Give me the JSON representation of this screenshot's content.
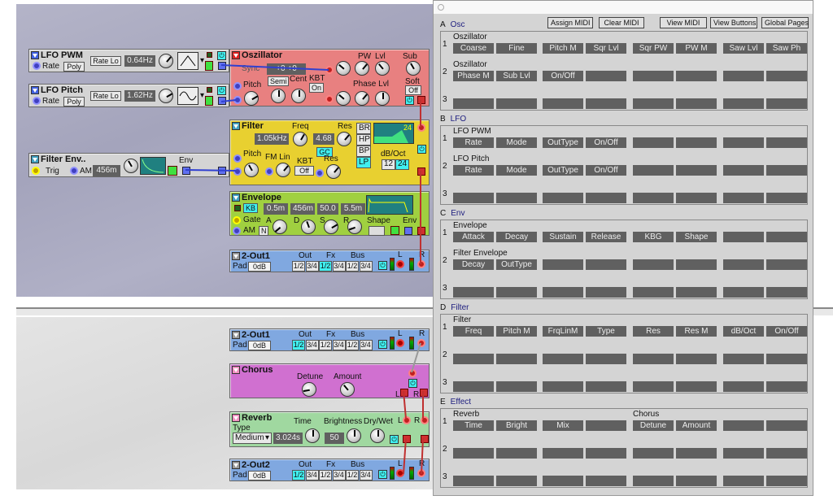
{
  "colors": {
    "oscillator": "#e88080",
    "filter": "#e8d030",
    "envelope": "#a0d040",
    "out": "#80a8e0",
    "chorus": "#d070d0",
    "reverb": "#a0d8a0",
    "lfo": "#d0d0d0",
    "cable_mod": "#3040d0",
    "cable_audio": "#c03030"
  },
  "lfo_pwm": {
    "title": "LFO PWM",
    "rate": "Rate",
    "poly": "Poly",
    "rate_lo": "Rate Lo",
    "value": "0.64Hz",
    "wave": "triangle"
  },
  "lfo_pitch": {
    "title": "LFO Pitch",
    "rate": "Rate",
    "poly": "Poly",
    "rate_lo": "Rate Lo",
    "value": "1.62Hz",
    "wave": "sine"
  },
  "osc": {
    "title": "Oszillator",
    "sync": "Sync",
    "display": "+0 +0",
    "pw": "PW",
    "lvl": "Lvl",
    "sub": "Sub",
    "semi": "Semi",
    "cent": "Cent",
    "kbt": "KBT",
    "kbt_val": "On",
    "phase": "Phase Lvl",
    "soft": "Soft",
    "soft_val": "Off",
    "pitch": "Pitch"
  },
  "filter": {
    "title": "Filter",
    "freq": "Freq",
    "freq_val": "1.05kHz",
    "res": "Res",
    "res_val": "4.68",
    "gc": "GC",
    "types": [
      "BR",
      "HP",
      "BP",
      "LP"
    ],
    "active_type": "LP",
    "graph_val": "24",
    "dboct": "dB/Oct",
    "slopes": [
      "12",
      "24"
    ],
    "active_slope": "24",
    "pitch": "Pitch",
    "fmlin": "FM Lin",
    "kbt": "KBT",
    "kbt_val": "Off",
    "res2": "Res"
  },
  "filter_env": {
    "title": "Filter Env..",
    "trig": "Trig",
    "am": "AM",
    "value": "456m",
    "env": "Env"
  },
  "envelope": {
    "title": "Envelope",
    "kb": "KB",
    "a_val": "0.5m",
    "d_val": "456m",
    "s_val": "50.0",
    "r_val": "5.5m",
    "gate": "Gate",
    "am": "AM",
    "n": "N",
    "a": "A",
    "d": "D",
    "s": "S",
    "r": "R",
    "shape": "Shape",
    "env": "Env"
  },
  "out1": {
    "title": "2-Out1",
    "pad": "Pad",
    "pad_val": "0dB",
    "out": "Out",
    "fx": "Fx",
    "bus": "Bus",
    "routes": [
      "1/2",
      "3/4",
      "1/2",
      "3/4",
      "1/2",
      "3/4"
    ],
    "active": 2,
    "l": "L",
    "r": "R"
  },
  "out1b": {
    "title": "2-Out1",
    "pad": "Pad",
    "pad_val": "0dB",
    "out": "Out",
    "fx": "Fx",
    "bus": "Bus",
    "routes": [
      "1/2",
      "3/4",
      "1/2",
      "3/4",
      "1/2",
      "3/4"
    ],
    "active": 0,
    "l": "L",
    "r": "R"
  },
  "chorus": {
    "title": "Chorus",
    "detune": "Detune",
    "amount": "Amount",
    "l": "L",
    "r": "R"
  },
  "reverb": {
    "title": "Reverb",
    "type": "Type",
    "type_val": "Medium",
    "time": "Time",
    "time_val": "3.024s",
    "brightness": "Brightness",
    "bright_val": "50",
    "drywet": "Dry/Wet",
    "l": "L",
    "r": "R"
  },
  "out2": {
    "title": "2-Out2",
    "pad": "Pad",
    "pad_val": "0dB",
    "out": "Out",
    "fx": "Fx",
    "bus": "Bus",
    "routes": [
      "1/2",
      "3/4",
      "1/2",
      "3/4",
      "1/2",
      "3/4"
    ],
    "active": 0,
    "l": "L",
    "r": "R"
  },
  "panel": {
    "buttons": [
      "Assign MIDI",
      "Clear MIDI",
      "View MIDI",
      "View Buttons",
      "Global Pages"
    ],
    "sections": [
      {
        "letter": "A",
        "name": "Osc",
        "rows": [
          {
            "groups": [
              {
                "label": "Oszillator",
                "col": 0
              }
            ],
            "cells": [
              "Coarse",
              "Fine",
              "Pitch M",
              "Sqr Lvl",
              "Sqr PW",
              "PW M",
              "Saw Lvl",
              "Saw Ph"
            ]
          },
          {
            "groups": [
              {
                "label": "Oszillator",
                "col": 0
              }
            ],
            "cells": [
              "Phase M",
              "Sub Lvl",
              "On/Off",
              "",
              "",
              "",
              "",
              ""
            ]
          },
          {
            "groups": [],
            "cells": [
              "",
              "",
              "",
              "",
              "",
              "",
              "",
              ""
            ]
          }
        ]
      },
      {
        "letter": "B",
        "name": "LFO",
        "rows": [
          {
            "groups": [
              {
                "label": "LFO PWM",
                "col": 0
              }
            ],
            "cells": [
              "Rate",
              "Mode",
              "OutType",
              "On/Off",
              "",
              "",
              "",
              ""
            ]
          },
          {
            "groups": [
              {
                "label": "LFO Pitch",
                "col": 0
              }
            ],
            "cells": [
              "Rate",
              "Mode",
              "OutType",
              "On/Off",
              "",
              "",
              "",
              ""
            ]
          },
          {
            "groups": [],
            "cells": [
              "",
              "",
              "",
              "",
              "",
              "",
              "",
              ""
            ]
          }
        ]
      },
      {
        "letter": "C",
        "name": "Env",
        "rows": [
          {
            "groups": [
              {
                "label": "Envelope",
                "col": 0
              }
            ],
            "cells": [
              "Attack",
              "Decay",
              "Sustain",
              "Release",
              "KBG",
              "Shape",
              "",
              ""
            ]
          },
          {
            "groups": [
              {
                "label": "Filter Envelope",
                "col": 0
              }
            ],
            "cells": [
              "Decay",
              "OutType",
              "",
              "",
              "",
              "",
              "",
              ""
            ]
          },
          {
            "groups": [],
            "cells": [
              "",
              "",
              "",
              "",
              "",
              "",
              "",
              ""
            ]
          }
        ]
      },
      {
        "letter": "D",
        "name": "Filter",
        "rows": [
          {
            "groups": [
              {
                "label": "Filter",
                "col": 0
              }
            ],
            "cells": [
              "Freq",
              "Pitch M",
              "FrqLinM",
              "Type",
              "Res",
              "Res M",
              "dB/Oct",
              "On/Off"
            ]
          },
          {
            "groups": [],
            "cells": [
              "",
              "",
              "",
              "",
              "",
              "",
              "",
              ""
            ]
          },
          {
            "groups": [],
            "cells": [
              "",
              "",
              "",
              "",
              "",
              "",
              "",
              ""
            ]
          }
        ]
      },
      {
        "letter": "E",
        "name": "Effect",
        "rows": [
          {
            "groups": [
              {
                "label": "Reverb",
                "col": 0
              },
              {
                "label": "Chorus",
                "col": 4
              }
            ],
            "cells": [
              "Time",
              "Bright",
              "Mix",
              "",
              "Detune",
              "Amount",
              "",
              ""
            ]
          },
          {
            "groups": [],
            "cells": [
              "",
              "",
              "",
              "",
              "",
              "",
              "",
              ""
            ]
          },
          {
            "groups": [],
            "cells": [
              "",
              "",
              "",
              "",
              "",
              "",
              "",
              ""
            ]
          }
        ]
      }
    ]
  }
}
